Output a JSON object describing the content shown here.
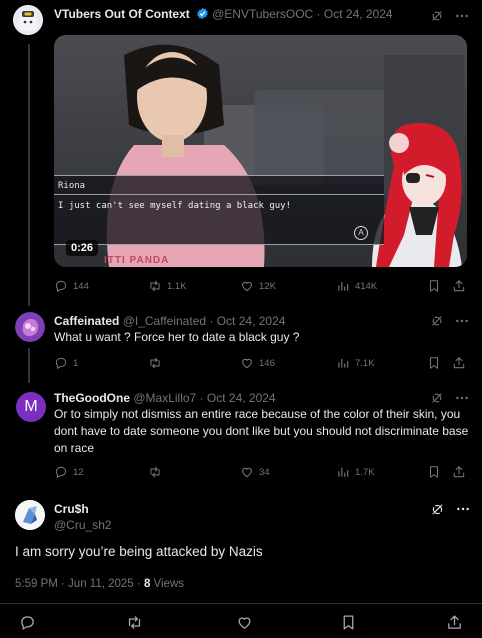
{
  "tweets": [
    {
      "author": "VTubers Out Of Context",
      "handle": "@ENVTubersOOC",
      "date": "Oct 24, 2024",
      "video": {
        "speaker": "Riona",
        "subtitle": "I just can't see myself dating a black guy!",
        "duration": "0:26",
        "button_label": "A",
        "shirt_text": "ITTI PANDA"
      },
      "stats": {
        "replies": "144",
        "reposts": "1.1K",
        "likes": "12K",
        "views": "414K"
      }
    },
    {
      "author": "Caffeinated",
      "handle": "@I_Caffeinated",
      "date": "Oct 24, 2024",
      "text": "What u want ? Force her to date a black guy ?",
      "stats": {
        "replies": "1",
        "reposts": "",
        "likes": "146",
        "views": "7.1K"
      }
    },
    {
      "author": "TheGoodOne",
      "handle": "@MaxLillo7",
      "date": "Oct 24, 2024",
      "avatar_letter": "M",
      "avatar_color": "#7b2ec0",
      "text": "Or to simply not dismiss an entire race because of the color of their skin, you dont have to date someone you dont like but you should not discriminate base on race",
      "stats": {
        "replies": "12",
        "reposts": "",
        "likes": "34",
        "views": "1.7K"
      }
    }
  ],
  "main_post": {
    "author": "Cru$h",
    "handle": "@Cru_sh2",
    "text": "I am sorry you’re being attacked by Nazis",
    "timestamp": "5:59 PM · Jun 11, 2025",
    "separator": " · ",
    "views_count": "8",
    "views_label": "Views"
  },
  "separator": " · ",
  "colors": {
    "background": "#000000",
    "accent": "#1d9bf0",
    "muted": "#71767b",
    "divider": "#2f3336"
  }
}
